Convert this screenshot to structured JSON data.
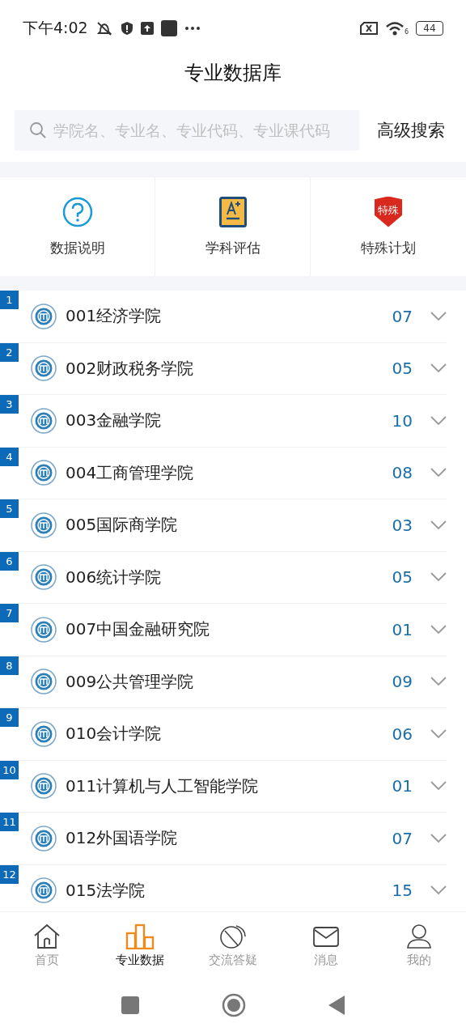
{
  "status_bar": {
    "time": "下午4:02",
    "battery": "44",
    "wifi_badge": "6"
  },
  "header": {
    "title": "专业数据库"
  },
  "search": {
    "placeholder": "学院名、专业名、专业代码、专业课代码",
    "advanced": "高级搜索"
  },
  "shortcuts": [
    {
      "kind": "help",
      "label": "数据说明"
    },
    {
      "kind": "grade",
      "label": "学科评估"
    },
    {
      "kind": "special",
      "label": "特殊计划",
      "badge": "特殊"
    }
  ],
  "colleges": [
    {
      "index": "1",
      "name": "001经济学院",
      "count": "07"
    },
    {
      "index": "2",
      "name": "002财政税务学院",
      "count": "05"
    },
    {
      "index": "3",
      "name": "003金融学院",
      "count": "10"
    },
    {
      "index": "4",
      "name": "004工商管理学院",
      "count": "08"
    },
    {
      "index": "5",
      "name": "005国际商学院",
      "count": "03"
    },
    {
      "index": "6",
      "name": "006统计学院",
      "count": "05"
    },
    {
      "index": "7",
      "name": "007中国金融研究院",
      "count": "01"
    },
    {
      "index": "8",
      "name": "009公共管理学院",
      "count": "09"
    },
    {
      "index": "9",
      "name": "010会计学院",
      "count": "06"
    },
    {
      "index": "10",
      "name": "011计算机与人工智能学院",
      "count": "01"
    },
    {
      "index": "11",
      "name": "012外国语学院",
      "count": "07"
    },
    {
      "index": "12",
      "name": "015法学院",
      "count": "15"
    }
  ],
  "tab_bar": [
    {
      "kind": "home",
      "label": "首页",
      "selected": false
    },
    {
      "kind": "data",
      "label": "专业数据",
      "selected": true
    },
    {
      "kind": "qa",
      "label": "交流答疑",
      "selected": false
    },
    {
      "kind": "message",
      "label": "消息",
      "selected": false
    },
    {
      "kind": "me",
      "label": "我的",
      "selected": false
    }
  ]
}
